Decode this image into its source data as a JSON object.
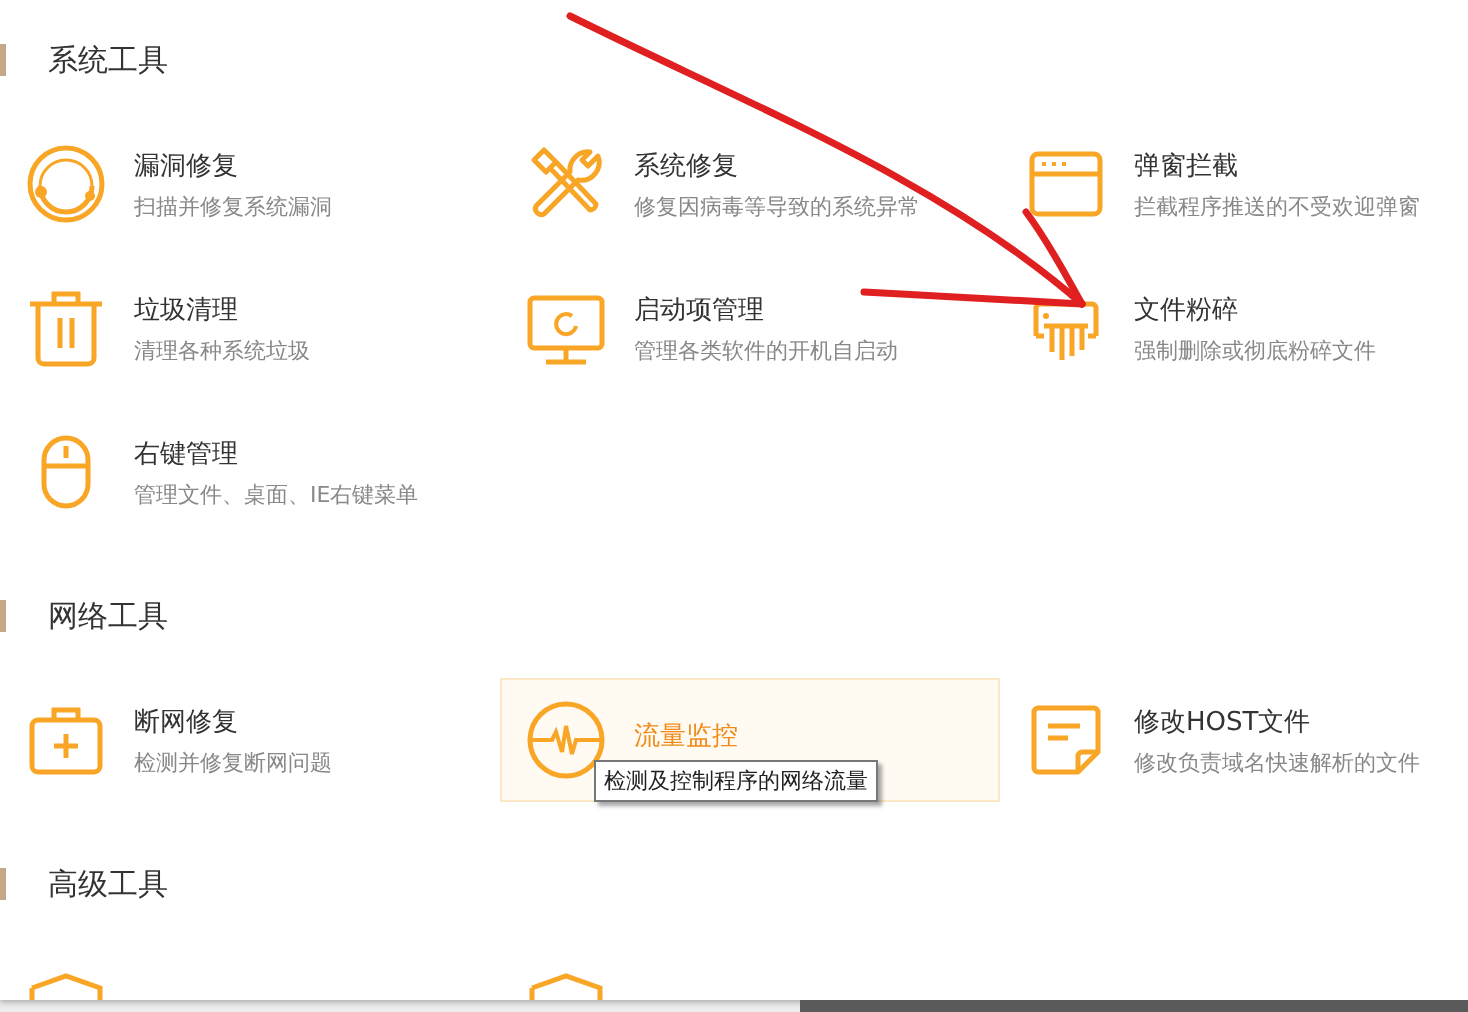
{
  "sections": [
    {
      "title": "系统工具",
      "items": [
        {
          "kind": "target",
          "title": "漏洞修复",
          "description": "扫描并修复系统漏洞",
          "hovered": false
        },
        {
          "kind": "tools",
          "title": "系统修复",
          "description": "修复因病毒等导致的系统异常",
          "hovered": false
        },
        {
          "kind": "window",
          "title": "弹窗拦截",
          "description": "拦截程序推送的不受欢迎弹窗",
          "hovered": false
        },
        {
          "kind": "trash",
          "title": "垃圾清理",
          "description": "清理各种系统垃圾",
          "hovered": false
        },
        {
          "kind": "monitor",
          "title": "启动项管理",
          "description": "管理各类软件的开机自启动",
          "hovered": false
        },
        {
          "kind": "shredder",
          "title": "文件粉碎",
          "description": "强制删除或彻底粉碎文件",
          "hovered": false
        },
        {
          "kind": "mouse",
          "title": "右键管理",
          "description": "管理文件、桌面、IE右键菜单",
          "hovered": false
        }
      ]
    },
    {
      "title": "网络工具",
      "items": [
        {
          "kind": "kit",
          "title": "断网修复",
          "description": "检测并修复断网问题",
          "hovered": false
        },
        {
          "kind": "pulse",
          "title": "流量监控",
          "hovered": true,
          "tooltip": "检测及控制程序的网络流量"
        },
        {
          "kind": "note",
          "title": "修改HOST文件",
          "description": "修改负责域名快速解析的文件",
          "hovered": false
        }
      ]
    },
    {
      "title": "高级工具",
      "items": [
        {
          "kind": "shield",
          "hovered": false
        },
        {
          "kind": "shield",
          "hovered": false
        }
      ]
    }
  ]
}
